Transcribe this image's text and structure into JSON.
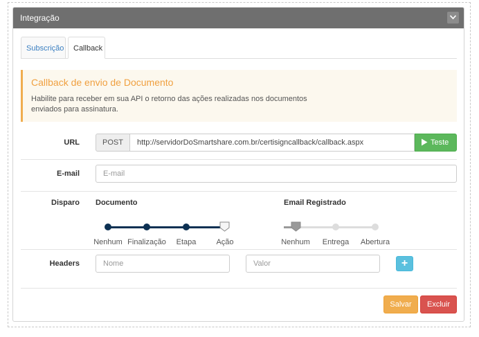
{
  "panel": {
    "title": "Integração"
  },
  "tabs": [
    {
      "label": "Subscrição",
      "active": false
    },
    {
      "label": "Callback",
      "active": true
    }
  ],
  "alert": {
    "title": "Callback de envio de Documento",
    "text": "Habilite para receber em sua API o retorno das ações realizadas nos documentos enviados para assinatura."
  },
  "url": {
    "label": "URL",
    "method": "POST",
    "value": "http://servidorDoSmartshare.com.br/certisigncallback/callback.aspx",
    "test_button": "Teste"
  },
  "email": {
    "label": "E-mail",
    "placeholder": "E-mail"
  },
  "disparo": {
    "label": "Disparo",
    "documento": {
      "title": "Documento",
      "steps": [
        "Nenhum",
        "Finalização",
        "Etapa",
        "Ação"
      ],
      "selected_index": 3
    },
    "email_registrado": {
      "title": "Email Registrado",
      "steps": [
        "Nenhum",
        "Entrega",
        "Abertura"
      ],
      "selected_index": 0
    }
  },
  "headers": {
    "label": "Headers",
    "name_placeholder": "Nome",
    "value_placeholder": "Valor",
    "add_button": "+"
  },
  "actions": {
    "save": "Salvar",
    "delete": "Excluir"
  },
  "colors": {
    "header_bg": "#6f6f6f",
    "alert_accent": "#f0ad4e",
    "slider_active": "#0d3153",
    "slider_inactive": "#dddddd",
    "success": "#5cb85c",
    "info": "#5bc0de",
    "warning": "#f0ad4e",
    "danger": "#d9534f"
  }
}
